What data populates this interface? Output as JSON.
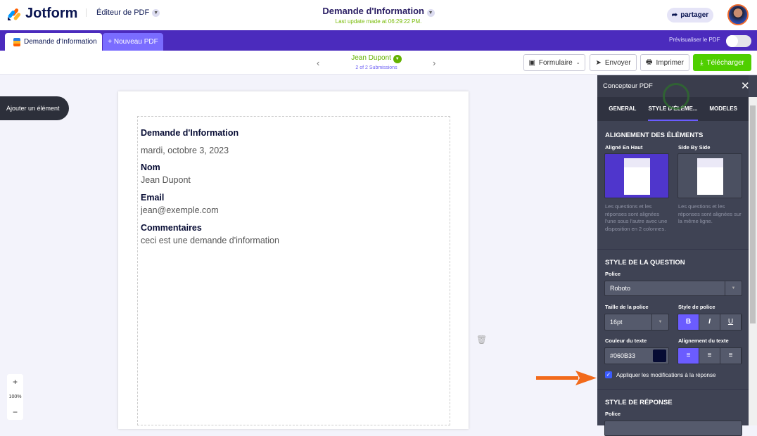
{
  "header": {
    "logo": "Jotform",
    "editor_label": "Éditeur de PDF",
    "title": "Demande d'Information",
    "last_update": "Last update made at 06:29:22 PM.",
    "share": "partager"
  },
  "tabs": [
    {
      "label": "Demande d'Information"
    },
    {
      "label": "+ Nouveau PDF"
    }
  ],
  "preview_label": "Prévisualiser le PDF",
  "preview_on": false,
  "submission": {
    "name": "Jean Dupont",
    "count": "2 of 2 Submissions"
  },
  "toolbar": {
    "form": "Formulaire",
    "send": "Envoyer",
    "print": "Imprimer",
    "download": "Télécharger"
  },
  "add_element": "Ajouter un élément",
  "zoom": {
    "plus": "+",
    "level": "100%",
    "minus": "−"
  },
  "document": {
    "title": "Demande d'Information",
    "date": "mardi, octobre 3, 2023",
    "fields": [
      {
        "q": "Nom",
        "a": "Jean Dupont"
      },
      {
        "q": "Email",
        "a": "jean@exemple.com"
      },
      {
        "q": "Commentaires",
        "a": "ceci est une demande d'information"
      }
    ]
  },
  "panel": {
    "title": "Concepteur PDF",
    "tabs": [
      "GENERAL",
      "STYLE D'ÉLÉME...",
      "MODELES"
    ],
    "align_heading": "ALIGNEMENT DES ÉLÉMENTS",
    "align_options": [
      {
        "label": "Aligné En Haut",
        "desc": "Les questions et les réponses sont alignées l'une sous l'autre avec une disposition en 2 colonnes."
      },
      {
        "label": "Side By Side",
        "desc": "Les questions et les réponses sont alignées sur la même ligne."
      }
    ],
    "question_heading": "STYLE DE LA QUESTION",
    "font_label": "Police",
    "font_value": "Roboto",
    "size_label": "Taille de la police",
    "size_value": "16pt",
    "style_label": "Style de police",
    "style_buttons": [
      "B",
      "I",
      "U"
    ],
    "color_label": "Couleur du texte",
    "color_value": "#060B33",
    "align_label": "Alignement du texte",
    "apply_label": "Appliquer les modifications à la réponse",
    "apply_checked": true,
    "answer_heading": "STYLE DE RÉPONSE",
    "answer_font_label": "Police"
  },
  "colors": {
    "brand": "#4b2bbd",
    "accent": "#6b5cff",
    "green": "#4fcf00",
    "text_color": "#060B33"
  }
}
